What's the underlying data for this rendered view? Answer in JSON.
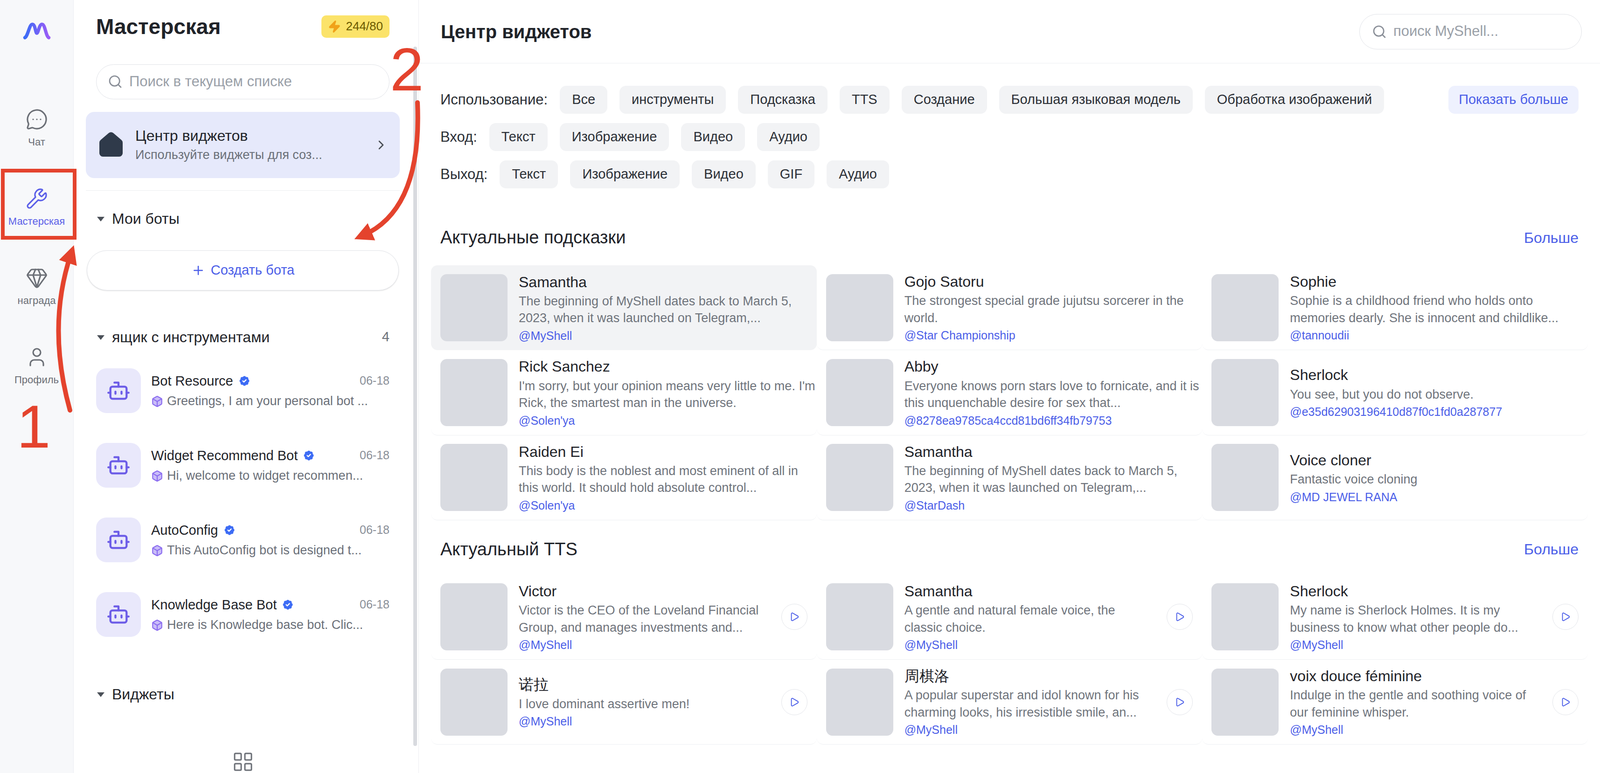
{
  "rail": {
    "items": [
      {
        "label": "Чат",
        "selected": false
      },
      {
        "label": "Мастерская",
        "selected": true
      },
      {
        "label": "награда",
        "selected": false
      },
      {
        "label": "Профиль",
        "selected": false
      }
    ]
  },
  "panel": {
    "title": "Мастерская",
    "energy": "244/80",
    "search": {
      "placeholder": "Поиск в текущем списке"
    },
    "widget_center": {
      "title": "Центр виджетов",
      "subtitle": "Используйте виджеты для соз..."
    },
    "my_bots": {
      "title": "Мои боты",
      "expanded": true,
      "create_button": "Создать бота"
    },
    "toolbox": {
      "title": "ящик с инструментами",
      "expanded": true,
      "count": "4",
      "items": [
        {
          "name": "Bot Resource",
          "verified": true,
          "date": "06-18",
          "description": "Greetings, I am your personal bot ..."
        },
        {
          "name": "Widget Recommend Bot",
          "verified": true,
          "date": "06-18",
          "description": "Hi, welcome to widget recommen..."
        },
        {
          "name": "AutoConfig",
          "verified": true,
          "date": "06-18",
          "description": "This AutoConfig bot is designed t..."
        },
        {
          "name": "Knowledge Base Bot",
          "verified": true,
          "date": "06-18",
          "description": "Here is Knowledge base bot. Clic..."
        }
      ]
    },
    "widgets": {
      "title": "Виджеты",
      "expanded": true
    }
  },
  "main": {
    "title": "Центр виджетов",
    "search": {
      "placeholder": "поиск MyShell..."
    },
    "filters": [
      {
        "label": "Использование:",
        "chips": [
          {
            "label": "Все",
            "selected": false
          },
          {
            "label": "инструменты",
            "selected": false
          },
          {
            "label": "Подсказка",
            "selected": false
          },
          {
            "label": "TTS",
            "selected": false
          },
          {
            "label": "Создание",
            "selected": false
          },
          {
            "label": "Большая языковая модель",
            "selected": false
          },
          {
            "label": "Обработка изображений",
            "selected": false
          }
        ]
      },
      {
        "label": "Вход:",
        "chips": [
          {
            "label": "Текст",
            "selected": false
          },
          {
            "label": "Изображение",
            "selected": false
          },
          {
            "label": "Видео",
            "selected": false
          },
          {
            "label": "Аудио",
            "selected": false
          }
        ]
      },
      {
        "label": "Выход:",
        "chips": [
          {
            "label": "Текст",
            "selected": false
          },
          {
            "label": "Изображение",
            "selected": false
          },
          {
            "label": "Видео",
            "selected": false
          },
          {
            "label": "GIF",
            "selected": false
          },
          {
            "label": "Аудио",
            "selected": false
          }
        ]
      }
    ],
    "show_more": "Показать больше",
    "sections": [
      {
        "title": "Актуальные подсказки",
        "kind": "prompts",
        "more": "Больше",
        "cards": [
          {
            "name": "Samantha",
            "description": "The beginning of MyShell dates back to March 5, 2023, when it was launched on Telegram,...",
            "author": "@MyShell",
            "selected": true
          },
          {
            "name": "Gojo Satoru",
            "description": "The strongest special grade jujutsu sorcerer in the world.",
            "author": "@Star Championship",
            "selected": false
          },
          {
            "name": "Sophie",
            "description": "Sophie is a childhood friend who holds onto memories dearly. She is innocent and childlike...",
            "author": "@tannoudii",
            "selected": false
          },
          {
            "name": "Rick Sanchez",
            "description": "I'm sorry, but your opinion means very little to me. I'm Rick, the smartest man in the universe.",
            "author": "@Solen'ya",
            "selected": false
          },
          {
            "name": "Abby",
            "description": "Everyone knows porn stars love to fornicate, and it is this unquenchable desire for sex that...",
            "author": "@8278ea9785ca4ccd81bd6ff34fb79753",
            "selected": false
          },
          {
            "name": "Sherlock",
            "description": "You see, but you do not observe.",
            "author": "@e35d62903196410d87f0c1fd0a287877",
            "selected": false
          },
          {
            "name": "Raiden Ei",
            "description": "This body is the noblest and most eminent of all in this world. It should hold absolute control...",
            "author": "@Solen'ya",
            "selected": false
          },
          {
            "name": "Samantha",
            "description": "The beginning of MyShell dates back to March 5, 2023, when it was launched on Telegram,...",
            "author": "@StarDash",
            "selected": false
          },
          {
            "name": "Voice cloner",
            "description": "Fantastic voice cloning",
            "author": "@MD JEWEL RANA",
            "selected": false
          }
        ]
      },
      {
        "title": "Актуальный TTS",
        "kind": "tts",
        "more": "Больше",
        "cards": [
          {
            "name": "Victor",
            "description": "Victor is the CEO of the Loveland Financial Group, and manages investments and...",
            "author": "@MyShell",
            "selected": false
          },
          {
            "name": "Samantha",
            "description": "A gentle and natural female voice, the classic choice.",
            "author": "@MyShell",
            "selected": false
          },
          {
            "name": "Sherlock",
            "description": "My name is Sherlock Holmes. It is my business to know what other people do...",
            "author": "@MyShell",
            "selected": false
          },
          {
            "name": "诺拉",
            "description": "I love dominant assertive men!",
            "author": "@MyShell",
            "selected": false
          },
          {
            "name": "周棋洛",
            "description": "A popular superstar and idol known for his charming looks, his irresistible smile, an...",
            "author": "@MyShell",
            "selected": false
          },
          {
            "name": "voix douce féminine",
            "description": "Indulge in the gentle and soothing voice of our feminine whisper.",
            "author": "@MyShell",
            "selected": false
          }
        ]
      }
    ]
  },
  "annotations": [
    {
      "label": "1"
    },
    {
      "label": "2"
    }
  ]
}
